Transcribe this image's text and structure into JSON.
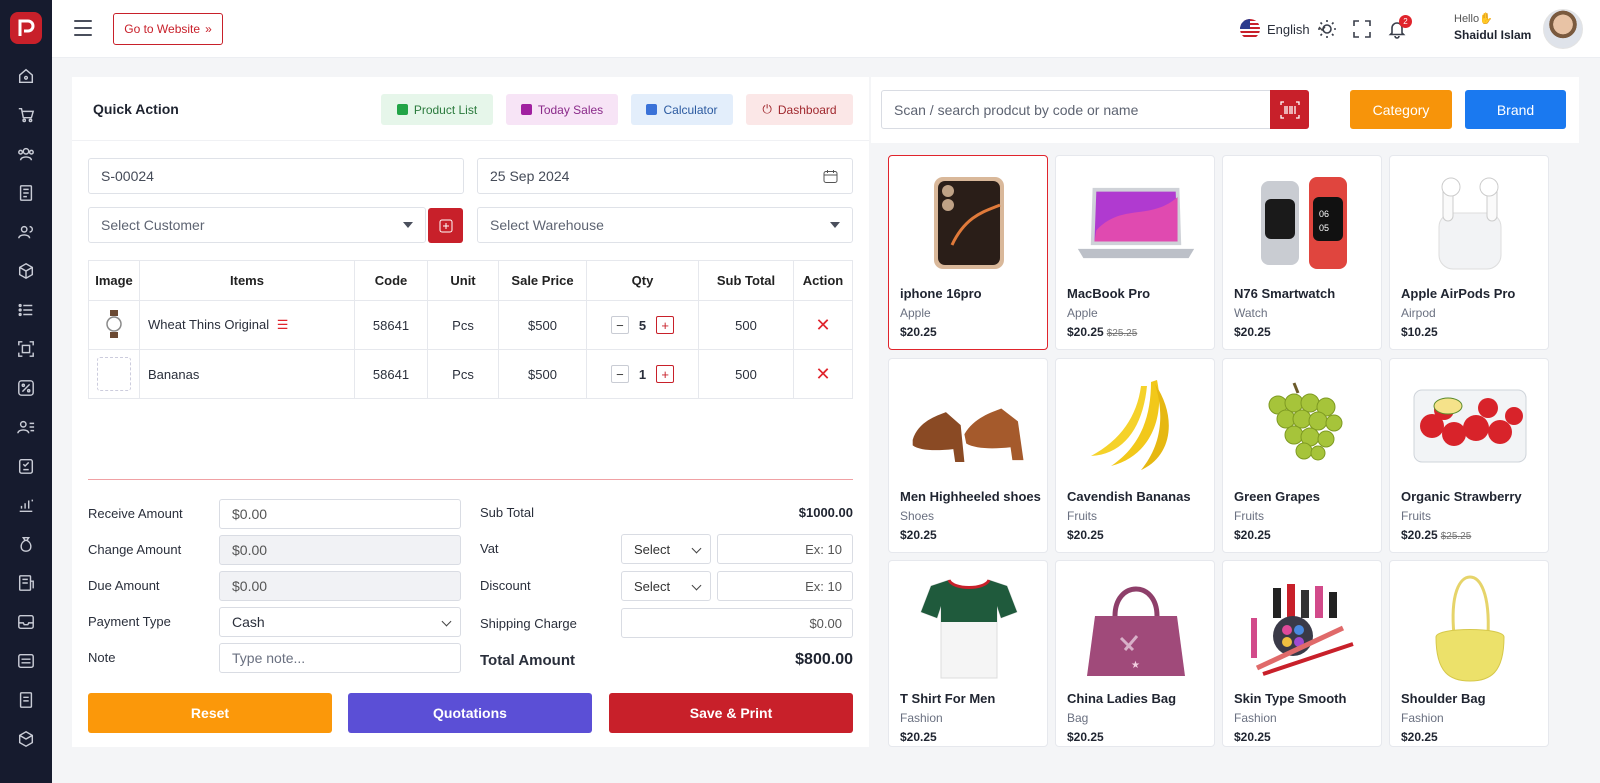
{
  "header": {
    "go_website": "Go to Website",
    "language": "English",
    "notification_count": "2",
    "greeting": "Hello✋",
    "user_name": "Shaidul Islam"
  },
  "quick_action": {
    "title": "Quick Action",
    "buttons": [
      "Product List",
      "Today Sales",
      "Calculator",
      "Dashboard"
    ]
  },
  "sale_form": {
    "invoice_no": "S-00024",
    "date": "25 Sep 2024",
    "customer_placeholder": "Select Customer",
    "warehouse_placeholder": "Select Warehouse"
  },
  "cart": {
    "columns": [
      "Image",
      "Items",
      "Code",
      "Unit",
      "Sale Price",
      "Qty",
      "Sub Total",
      "Action"
    ],
    "rows": [
      {
        "item": "Wheat Thins Original",
        "code": "58641",
        "unit": "Pcs",
        "price": "$500",
        "qty": "5",
        "subtotal": "500"
      },
      {
        "item": "Bananas",
        "code": "58641",
        "unit": "Pcs",
        "price": "$500",
        "qty": "1",
        "subtotal": "500"
      }
    ]
  },
  "payment": {
    "receive_label": "Receive Amount",
    "receive_value": "$0.00",
    "change_label": "Change Amount",
    "change_value": "$0.00",
    "due_label": "Due Amount",
    "due_value": "$0.00",
    "type_label": "Payment Type",
    "type_value": "Cash",
    "note_label": "Note",
    "note_placeholder": "Type note..."
  },
  "totals": {
    "subtotal_label": "Sub Total",
    "subtotal_value": "$1000.00",
    "vat_label": "Vat",
    "vat_select": "Select",
    "vat_placeholder": "Ex: 10",
    "discount_label": "Discount",
    "discount_select": "Select",
    "discount_placeholder": "Ex: 10",
    "shipping_label": "Shipping Charge",
    "shipping_value": "$0.00",
    "total_label": "Total Amount",
    "total_value": "$800.00"
  },
  "actions": {
    "reset": "Reset",
    "quotations": "Quotations",
    "save_print": "Save & Print"
  },
  "search": {
    "placeholder": "Scan / search prodcut by code or name",
    "category": "Category",
    "brand": "Brand"
  },
  "products": [
    {
      "name": "iphone 16pro",
      "category": "Apple",
      "price": "$20.25",
      "old_price": ""
    },
    {
      "name": "MacBook Pro",
      "category": "Apple",
      "price": "$20.25",
      "old_price": "$25.25"
    },
    {
      "name": "N76 Smartwatch",
      "category": "Watch",
      "price": "$20.25",
      "old_price": ""
    },
    {
      "name": "Apple AirPods Pro",
      "category": "Airpod",
      "price": "$10.25",
      "old_price": ""
    },
    {
      "name": "Men Highheeled shoes",
      "category": "Shoes",
      "price": "$20.25",
      "old_price": ""
    },
    {
      "name": "Cavendish Bananas",
      "category": "Fruits",
      "price": "$20.25",
      "old_price": ""
    },
    {
      "name": "Green Grapes",
      "category": "Fruits",
      "price": "$20.25",
      "old_price": ""
    },
    {
      "name": "Organic Strawberry",
      "category": "Fruits",
      "price": "$20.25",
      "old_price": "$25.25"
    },
    {
      "name": "T Shirt For Men",
      "category": "Fashion",
      "price": "$20.25",
      "old_price": ""
    },
    {
      "name": "China Ladies Bag",
      "category": "Bag",
      "price": "$20.25",
      "old_price": ""
    },
    {
      "name": "Skin Type Smooth",
      "category": "Fashion",
      "price": "$20.25",
      "old_price": ""
    },
    {
      "name": "Shoulder Bag",
      "category": "Fashion",
      "price": "$20.25",
      "old_price": ""
    }
  ],
  "colors": {
    "brand_red": "#c8202a",
    "orange": "#f7940a",
    "blue": "#1a79f0",
    "purple": "#5b4fd6",
    "sidebar": "#161b2e"
  }
}
